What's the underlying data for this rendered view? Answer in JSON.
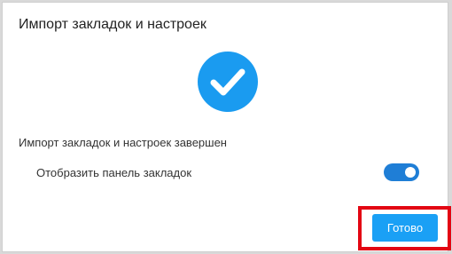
{
  "dialog": {
    "title": "Импорт закладок и настроек",
    "status_text": "Импорт закладок и настроек завершен",
    "success_icon": "checkmark-circle-icon",
    "bookmarks_bar": {
      "label": "Отобразить панель закладок",
      "enabled": true
    },
    "done_button_label": "Готово"
  },
  "colors": {
    "accent": "#1a9bf0",
    "toggle": "#1f7ed6",
    "button": "#1aa0f5",
    "highlight": "#e30613"
  }
}
